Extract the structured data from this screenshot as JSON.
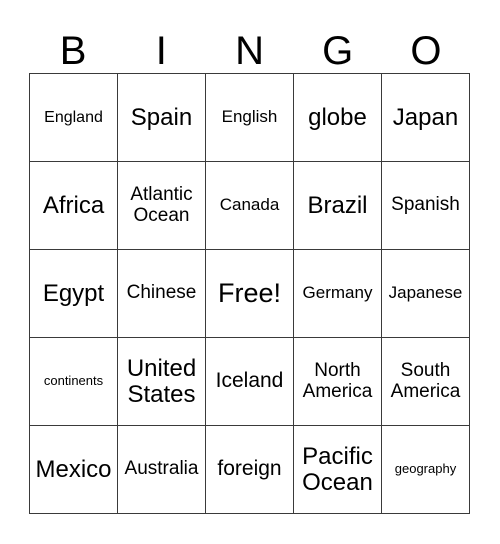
{
  "card": {
    "header_letters": [
      "B",
      "I",
      "N",
      "G",
      "O"
    ],
    "rows": [
      [
        {
          "text": "England",
          "size": "s"
        },
        {
          "text": "Spain",
          "size": "l"
        },
        {
          "text": "English",
          "size": "sm"
        },
        {
          "text": "globe",
          "size": "l"
        },
        {
          "text": "Japan",
          "size": "l"
        }
      ],
      [
        {
          "text": "Africa",
          "size": "l"
        },
        {
          "text": "Atlantic\nOcean",
          "size": "m"
        },
        {
          "text": "Canada",
          "size": "sm"
        },
        {
          "text": "Brazil",
          "size": "l"
        },
        {
          "text": "Spanish",
          "size": "m"
        }
      ],
      [
        {
          "text": "Egypt",
          "size": "l"
        },
        {
          "text": "Chinese",
          "size": "m"
        },
        {
          "text": "Free!",
          "size": "xl"
        },
        {
          "text": "Germany",
          "size": "sm"
        },
        {
          "text": "Japanese",
          "size": "sm"
        }
      ],
      [
        {
          "text": "continents",
          "size": "xs"
        },
        {
          "text": "United\nStates",
          "size": "l"
        },
        {
          "text": "Iceland",
          "size": "ml"
        },
        {
          "text": "North\nAmerica",
          "size": "m"
        },
        {
          "text": "South\nAmerica",
          "size": "m"
        }
      ],
      [
        {
          "text": "Mexico",
          "size": "l"
        },
        {
          "text": "Australia",
          "size": "m"
        },
        {
          "text": "foreign",
          "size": "ml"
        },
        {
          "text": "Pacific\nOcean",
          "size": "l"
        },
        {
          "text": "geography",
          "size": "xs"
        }
      ]
    ],
    "free_space": {
      "row": 2,
      "col": 2,
      "label": "Free!"
    },
    "colors": {
      "text": "#000000",
      "grid_line": "#3a3a3a",
      "background": "#ffffff"
    }
  }
}
